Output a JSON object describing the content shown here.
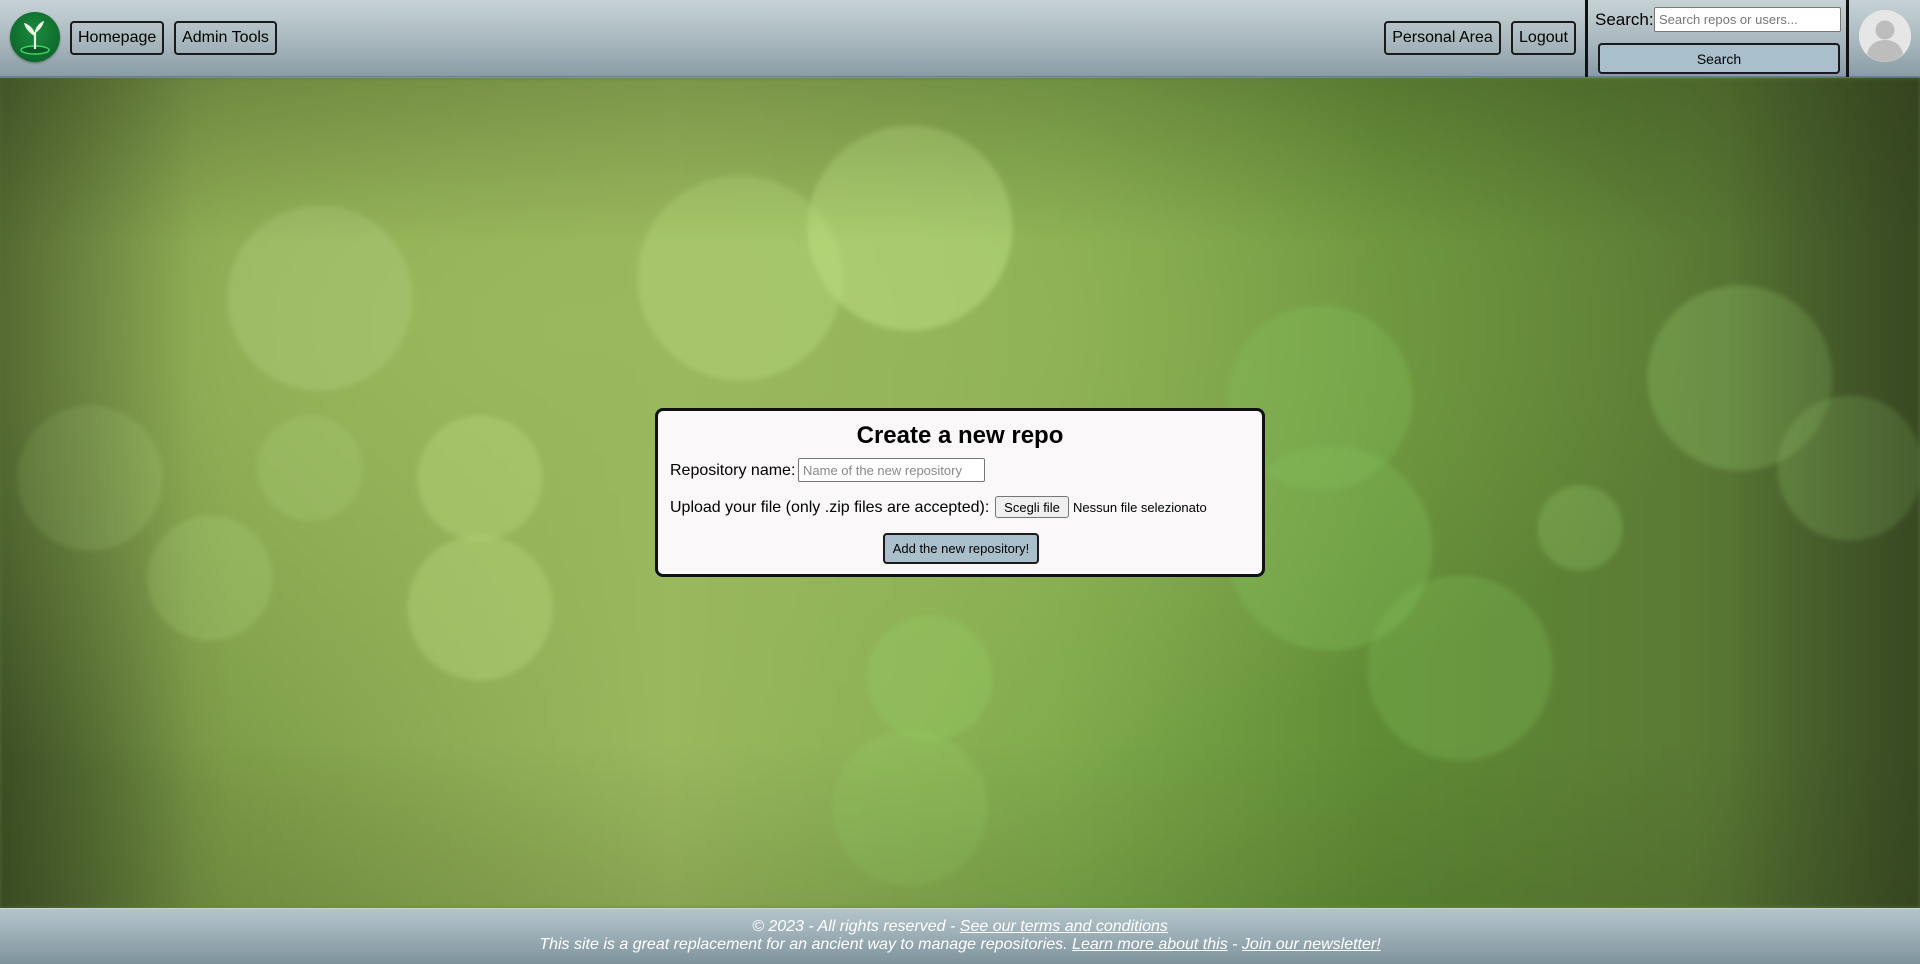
{
  "header": {
    "logo_icon": "sprout-logo-icon",
    "nav": {
      "homepage": "Homepage",
      "admin_tools": "Admin Tools",
      "personal_area": "Personal Area",
      "logout": "Logout"
    },
    "search": {
      "label": "Search:",
      "placeholder": "Search repos or users...",
      "value": "",
      "button": "Search"
    },
    "avatar_icon": "user-avatar-icon"
  },
  "form": {
    "title": "Create a new repo",
    "name_label": "Repository name:",
    "name_placeholder": "Name of the new repository",
    "name_value": "",
    "upload_label": "Upload your file (only .zip files are accepted):",
    "file_button": "Scegli file",
    "file_status": "Nessun file selezionato",
    "submit": "Add the new repository!"
  },
  "footer": {
    "copyright": "© 2023 - All rights reserved - ",
    "terms_link": "See our terms and conditions",
    "tagline": "This site is a great replacement for an ancient way to manage repositories. ",
    "learn_link": "Learn more about this",
    "separator": " - ",
    "newsletter_link": "Join our newsletter!"
  },
  "colors": {
    "header_bg": "#aebdc2",
    "button_accent": "#a9bfcc",
    "logo_green": "#0d6a2c",
    "card_bg": "#faf8f9"
  }
}
